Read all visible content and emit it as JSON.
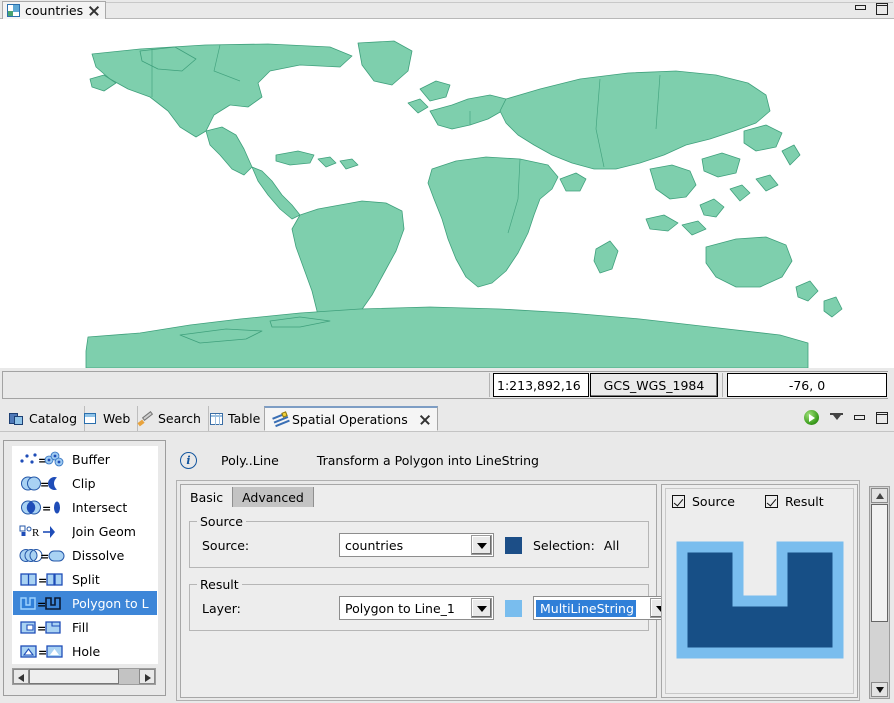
{
  "window": {
    "minimize_label": "Minimize",
    "maximize_label": "Maximize"
  },
  "editor": {
    "tab_label": "countries",
    "tab_icon": "map-layer-icon",
    "close_icon": "close-icon"
  },
  "map": {
    "land_fill": "#7ecfad",
    "land_stroke": "#3fa07c",
    "background": "#ffffff"
  },
  "statusbar": {
    "scale": "1:213,892,16",
    "crs": "GCS_WGS_1984",
    "coordinates": "-76, 0"
  },
  "views": {
    "tabs": [
      {
        "label": "Catalog",
        "icon": "catalog-icon",
        "active": false,
        "closable": false
      },
      {
        "label": "Web",
        "icon": "web-icon",
        "active": false,
        "closable": false
      },
      {
        "label": "Search",
        "icon": "search-pencil-icon",
        "active": false,
        "closable": false
      },
      {
        "label": "Table",
        "icon": "table-icon",
        "active": false,
        "closable": false
      },
      {
        "label": "Spatial Operations",
        "icon": "spatial-operations-icon",
        "active": true,
        "closable": true
      }
    ],
    "controls": {
      "run_icon": "play-run-icon",
      "menu_icon": "chevron-down-icon",
      "minimize_icon": "minimize-icon",
      "maximize_icon": "maximize-icon"
    }
  },
  "operations": {
    "items": [
      {
        "label": "Buffer",
        "icon": "buffer-op-icon",
        "selected": false
      },
      {
        "label": "Clip",
        "icon": "clip-op-icon",
        "selected": false
      },
      {
        "label": "Intersect",
        "icon": "intersect-op-icon",
        "selected": false
      },
      {
        "label": "Join Geom",
        "icon": "join-geometry-op-icon",
        "selected": false
      },
      {
        "label": "Dissolve",
        "icon": "dissolve-op-icon",
        "selected": false
      },
      {
        "label": "Split",
        "icon": "split-op-icon",
        "selected": false
      },
      {
        "label": "Polygon to L",
        "icon": "polygon-to-line-op-icon",
        "selected": true
      },
      {
        "label": "Fill",
        "icon": "fill-op-icon",
        "selected": false
      },
      {
        "label": "Hole",
        "icon": "hole-op-icon",
        "selected": false
      }
    ],
    "scroll_left_icon": "scroll-left-arrow-icon",
    "scroll_right_icon": "scroll-right-arrow-icon"
  },
  "info": {
    "icon": "info-icon",
    "glyph": "i",
    "name": "Poly..Line",
    "description": "Transform a Polygon into LineString"
  },
  "tabs": {
    "basic": "Basic",
    "advanced": "Advanced"
  },
  "source_group": {
    "title": "Source",
    "label": "Source:",
    "value": "countries",
    "swatch_color": "#1c4e87",
    "selection_label": "Selection:",
    "selection_value": "All"
  },
  "result_group": {
    "title": "Result",
    "label": "Layer:",
    "layer_value": "Polygon to Line_1",
    "swatch_color": "#79bdee",
    "geometry_value": "MultiLineString"
  },
  "preview": {
    "source_label": "Source",
    "source_checked": true,
    "result_label": "Result",
    "result_checked": true,
    "shape_fill": "#174f86",
    "shape_outline": "#79bdee"
  },
  "scrollbar": {
    "up_icon": "scroll-up-arrow-icon",
    "down_icon": "scroll-down-arrow-icon"
  }
}
